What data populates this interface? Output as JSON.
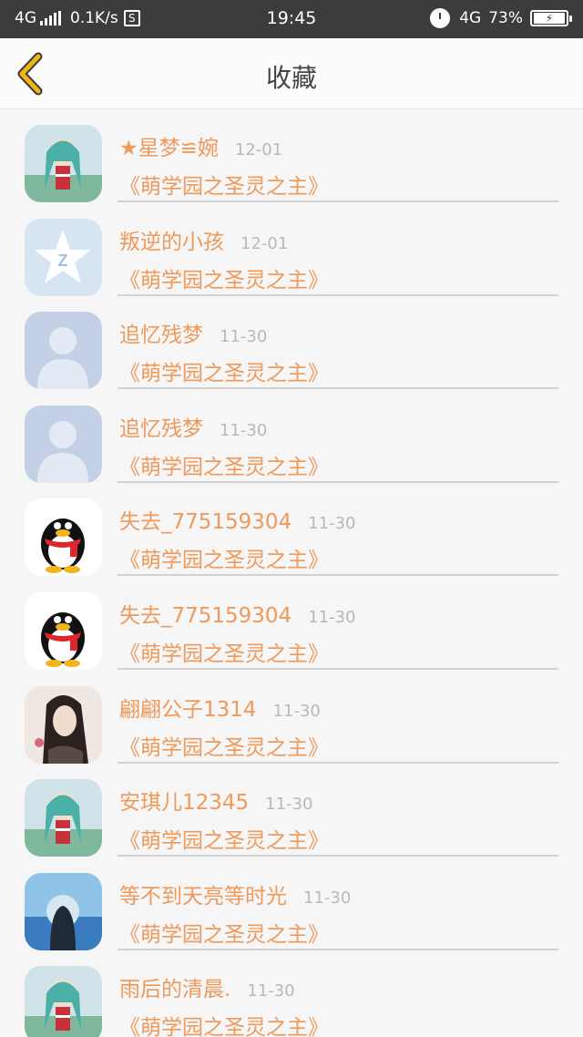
{
  "status_bar": {
    "network": "4G",
    "speed": "0.1K/s",
    "s_icon_label": "S",
    "time": "19:45",
    "network_right": "4G",
    "battery": "73%"
  },
  "header": {
    "title": "收藏",
    "accent_color": "#f0b418"
  },
  "favorites": [
    {
      "name": "★星梦≌婉",
      "time": "12-01",
      "book": "《萌学园之圣灵之主》",
      "avatar": "anime-girl-avatar"
    },
    {
      "name": "叛逆的小孩",
      "time": "12-01",
      "book": "《萌学园之圣灵之主》",
      "avatar": "qzone-star-avatar"
    },
    {
      "name": "追忆残梦",
      "time": "11-30",
      "book": "《萌学园之圣灵之主》",
      "avatar": "default-person-avatar"
    },
    {
      "name": "追忆残梦",
      "time": "11-30",
      "book": "《萌学园之圣灵之主》",
      "avatar": "default-person-avatar"
    },
    {
      "name": "失去_775159304",
      "time": "11-30",
      "book": "《萌学园之圣灵之主》",
      "avatar": "qq-penguin-avatar"
    },
    {
      "name": "失去_775159304",
      "time": "11-30",
      "book": "《萌学园之圣灵之主》",
      "avatar": "qq-penguin-avatar"
    },
    {
      "name": "翩翩公子1314",
      "time": "11-30",
      "book": "《萌学园之圣灵之主》",
      "avatar": "anime-man-avatar"
    },
    {
      "name": "安琪儿12345",
      "time": "11-30",
      "book": "《萌学园之圣灵之主》",
      "avatar": "anime-girl-avatar"
    },
    {
      "name": "等不到天亮等时光",
      "time": "11-30",
      "book": "《萌学园之圣灵之主》",
      "avatar": "seaside-girl-avatar"
    },
    {
      "name": "雨后的清晨.",
      "time": "11-30",
      "book": "《萌学园之圣灵之主》",
      "avatar": "anime-girl-avatar"
    }
  ],
  "colors": {
    "name_text": "#ee9a5c",
    "time_text": "#b9b9b9",
    "background": "#f6f6f6"
  }
}
